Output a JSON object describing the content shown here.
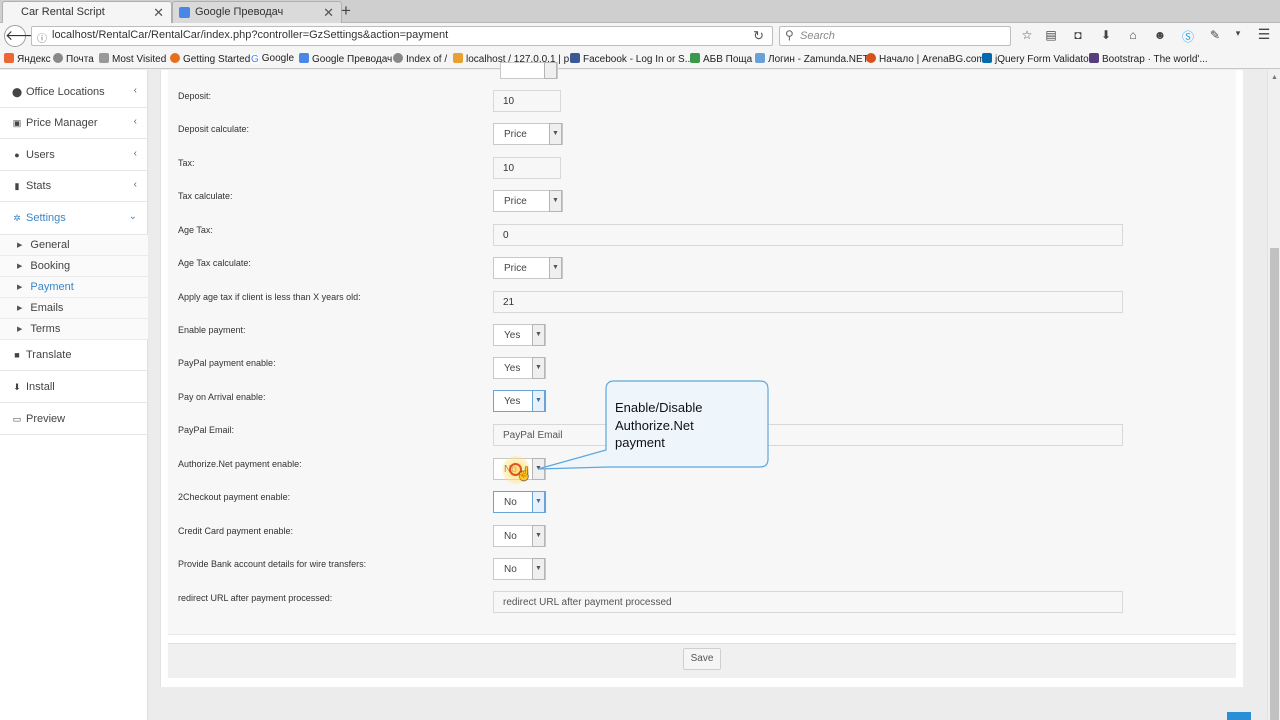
{
  "browser": {
    "tabs": [
      {
        "label": "Car Rental Script",
        "active": true
      },
      {
        "label": "Google Преводач",
        "active": false
      }
    ],
    "url": "localhost/RentalCar/RentalCar/index.php?controller=GzSettings&action=payment",
    "search_placeholder": "Search",
    "bookmarks": [
      "Яндекс",
      "Почта",
      "Most Visited",
      "Getting Started",
      "Google",
      "Google Преводач",
      "Index of /",
      "localhost / 127.0.0.1 | p...",
      "Facebook - Log In or S...",
      "АБВ Поща",
      "Логин - Zamunda.NET",
      "Начало | ArenaBG.com",
      "jQuery Form Validator",
      "Bootstrap · The world'..."
    ]
  },
  "sidebar": {
    "items": [
      {
        "label": "Office Locations",
        "icon": "map-marker-icon"
      },
      {
        "label": "Price Manager",
        "icon": "money-icon"
      },
      {
        "label": "Users",
        "icon": "user-icon"
      },
      {
        "label": "Stats",
        "icon": "bar-chart-icon"
      },
      {
        "label": "Settings",
        "icon": "gears-icon"
      }
    ],
    "settings_sub": [
      "General",
      "Booking",
      "Payment",
      "Emails",
      "Terms"
    ],
    "bottom_items": [
      {
        "label": "Translate",
        "icon": "book-icon"
      },
      {
        "label": "Install",
        "icon": "download-icon"
      },
      {
        "label": "Preview",
        "icon": "laptop-icon"
      }
    ]
  },
  "form": {
    "deposit_label": "Deposit:",
    "deposit_value": "10",
    "deposit_calc_label": "Deposit calculate:",
    "deposit_calc_value": "Price",
    "tax_label": "Tax:",
    "tax_value": "10",
    "tax_calc_label": "Tax calculate:",
    "tax_calc_value": "Price",
    "age_tax_label": "Age Tax:",
    "age_tax_value": "0",
    "age_tax_calc_label": "Age Tax calculate:",
    "age_tax_calc_value": "Price",
    "age_limit_label": "Apply age tax if client is less than X years old:",
    "age_limit_value": "21",
    "enable_payment_label": "Enable payment:",
    "enable_payment_value": "Yes",
    "paypal_enable_label": "PayPal payment enable:",
    "paypal_enable_value": "Yes",
    "arrival_enable_label": "Pay on Arrival enable:",
    "arrival_enable_value": "Yes",
    "paypal_email_label": "PayPal Email:",
    "paypal_email_placeholder": "PayPal Email",
    "authorize_label": "Authorize.Net payment enable:",
    "authorize_value": "No",
    "checkout_label": "2Checkout payment enable:",
    "checkout_value": "No",
    "credit_card_label": "Credit Card payment enable:",
    "credit_card_value": "No",
    "bank_label": "Provide Bank account details for wire transfers:",
    "bank_value": "No",
    "redirect_label": "redirect URL after payment processed:",
    "redirect_placeholder": "redirect URL after payment processed",
    "save_label": "Save"
  },
  "callout": {
    "lines": [
      "Enable/Disable",
      "Authorize.Net",
      "payment"
    ],
    "fill": "#eef6fc",
    "stroke": "#5ea7dc"
  }
}
